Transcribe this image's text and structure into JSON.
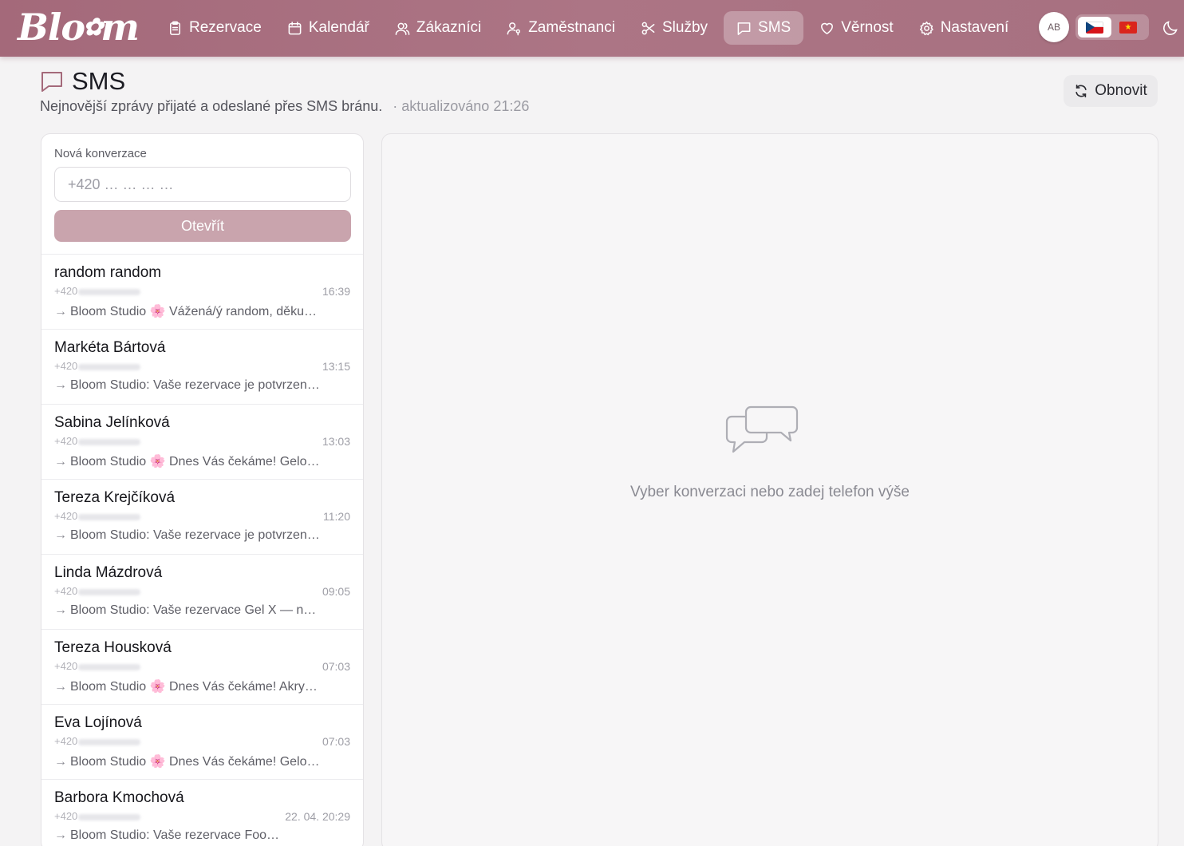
{
  "app": {
    "logo_text_left": "Blo",
    "logo_flower": "✿",
    "logo_text_right": "m",
    "brand_color": "#a4697a"
  },
  "nav": {
    "items": [
      {
        "label": "Rezervace",
        "icon": "clipboard-icon"
      },
      {
        "label": "Kalendář",
        "icon": "calendar-icon"
      },
      {
        "label": "Zákazníci",
        "icon": "users-icon"
      },
      {
        "label": "Zaměstnanci",
        "icon": "user-key-icon"
      },
      {
        "label": "Služby",
        "icon": "scissors-icon"
      },
      {
        "label": "SMS",
        "icon": "message-icon",
        "active": true
      },
      {
        "label": "Věrnost",
        "icon": "heart-icon"
      },
      {
        "label": "Nastavení",
        "icon": "gear-icon"
      }
    ],
    "avatar_initials": "AB",
    "languages": [
      "cs",
      "vi"
    ],
    "selected_language": "cs"
  },
  "page": {
    "title": "SMS",
    "subtitle": "Nejnovější zprávy přijaté a odeslané přes SMS bránu.",
    "updated": "· aktualizováno 21:26",
    "refresh_label": "Obnovit"
  },
  "new_conversation": {
    "label": "Nová konverzace",
    "placeholder": "+420 … … … …",
    "value": "",
    "open_label": "Otevřít"
  },
  "conversations": [
    {
      "name": "random random",
      "phone_prefix": "+420",
      "time": "16:39",
      "preview": "Bloom Studio 🌸 Vážená/ý random, děku…"
    },
    {
      "name": "Markéta Bártová",
      "phone_prefix": "+420",
      "time": "13:15",
      "preview": "Bloom Studio: Vaše rezervace je potvrzen…"
    },
    {
      "name": "Sabina Jelínková",
      "phone_prefix": "+420",
      "time": "13:03",
      "preview": "Bloom Studio 🌸 Dnes Vás čekáme! Gelo…"
    },
    {
      "name": "Tereza Krejčíková",
      "phone_prefix": "+420",
      "time": "11:20",
      "preview": "Bloom Studio: Vaše rezervace je potvrzen…"
    },
    {
      "name": "Linda Mázdrová",
      "phone_prefix": "+420",
      "time": "09:05",
      "preview": "Bloom Studio: Vaše rezervace Gel X — n…"
    },
    {
      "name": "Tereza Housková",
      "phone_prefix": "+420",
      "time": "07:03",
      "preview": "Bloom Studio 🌸 Dnes Vás čekáme! Akry…"
    },
    {
      "name": "Eva Lojínová",
      "phone_prefix": "+420",
      "time": "07:03",
      "preview": "Bloom Studio 🌸 Dnes Vás čekáme! Gelo…"
    },
    {
      "name": "Barbora Kmochová",
      "phone_prefix": "+420",
      "time": "22. 04. 20:29",
      "preview": "Bloom Studio: Vaše rezervace Foo…"
    }
  ],
  "empty_state": {
    "icon": "chat-bubbles-icon",
    "text": "Vyber konverzaci nebo zadej telefon výše"
  }
}
